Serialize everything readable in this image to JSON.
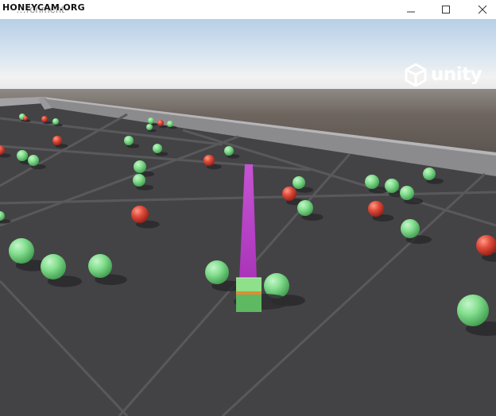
{
  "window": {
    "title": "…ronment",
    "watermark": "HONEYCAM.ORG"
  },
  "brand": {
    "logo_text": "unity"
  },
  "colors": {
    "sky_top": "#bcd3e8",
    "horizon": "#ececec",
    "ground_far": "#6f6660",
    "floor": "#414143",
    "wall": "#8c8c8e",
    "good_ball": "#7fdc8a",
    "bad_ball": "#e04a3a",
    "agent_top": "#7fd97f",
    "agent_band": "#e0903a",
    "beam": "#c44bd0"
  },
  "scene": {
    "agent": "green cube agent with purple raycast beam",
    "good_items": "green spheres",
    "bad_items": "red spheres"
  }
}
